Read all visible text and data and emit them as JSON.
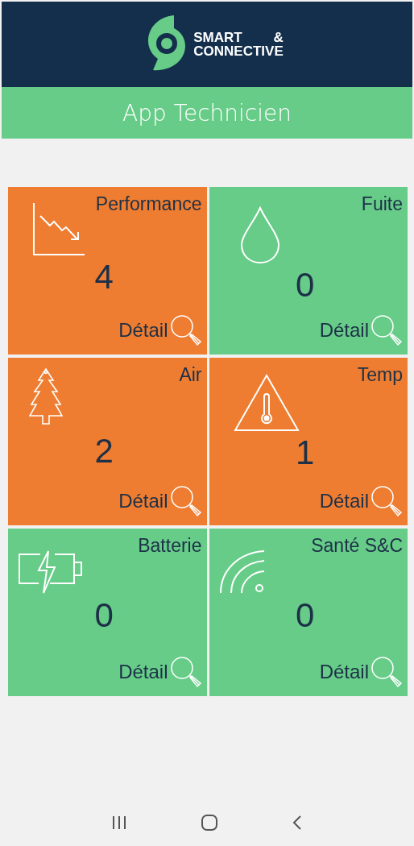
{
  "header": {
    "logo": {
      "line1": "SMART",
      "ampersand": "&",
      "line2": "CONNECTIVE"
    }
  },
  "title": "App Technicien",
  "tiles": [
    {
      "label": "Performance",
      "kind": "chart",
      "count": "4",
      "color": "#ee7d31",
      "link": "Détail"
    },
    {
      "label": "Fuite",
      "kind": "drop",
      "count": "0",
      "color": "#66cc88",
      "link": "Détail"
    },
    {
      "label": "Air",
      "kind": "tree",
      "count": "2",
      "color": "#ee7d31",
      "link": "Détail"
    },
    {
      "label": "Temp",
      "kind": "thermometer",
      "count": "1",
      "color": "#ee7d31",
      "link": "Détail"
    },
    {
      "label": "Batterie",
      "kind": "battery",
      "count": "0",
      "color": "#66cc88",
      "link": "Détail"
    },
    {
      "label": "Santé S&C",
      "kind": "signal",
      "count": "0",
      "color": "#66cc88",
      "link": "Détail"
    }
  ]
}
